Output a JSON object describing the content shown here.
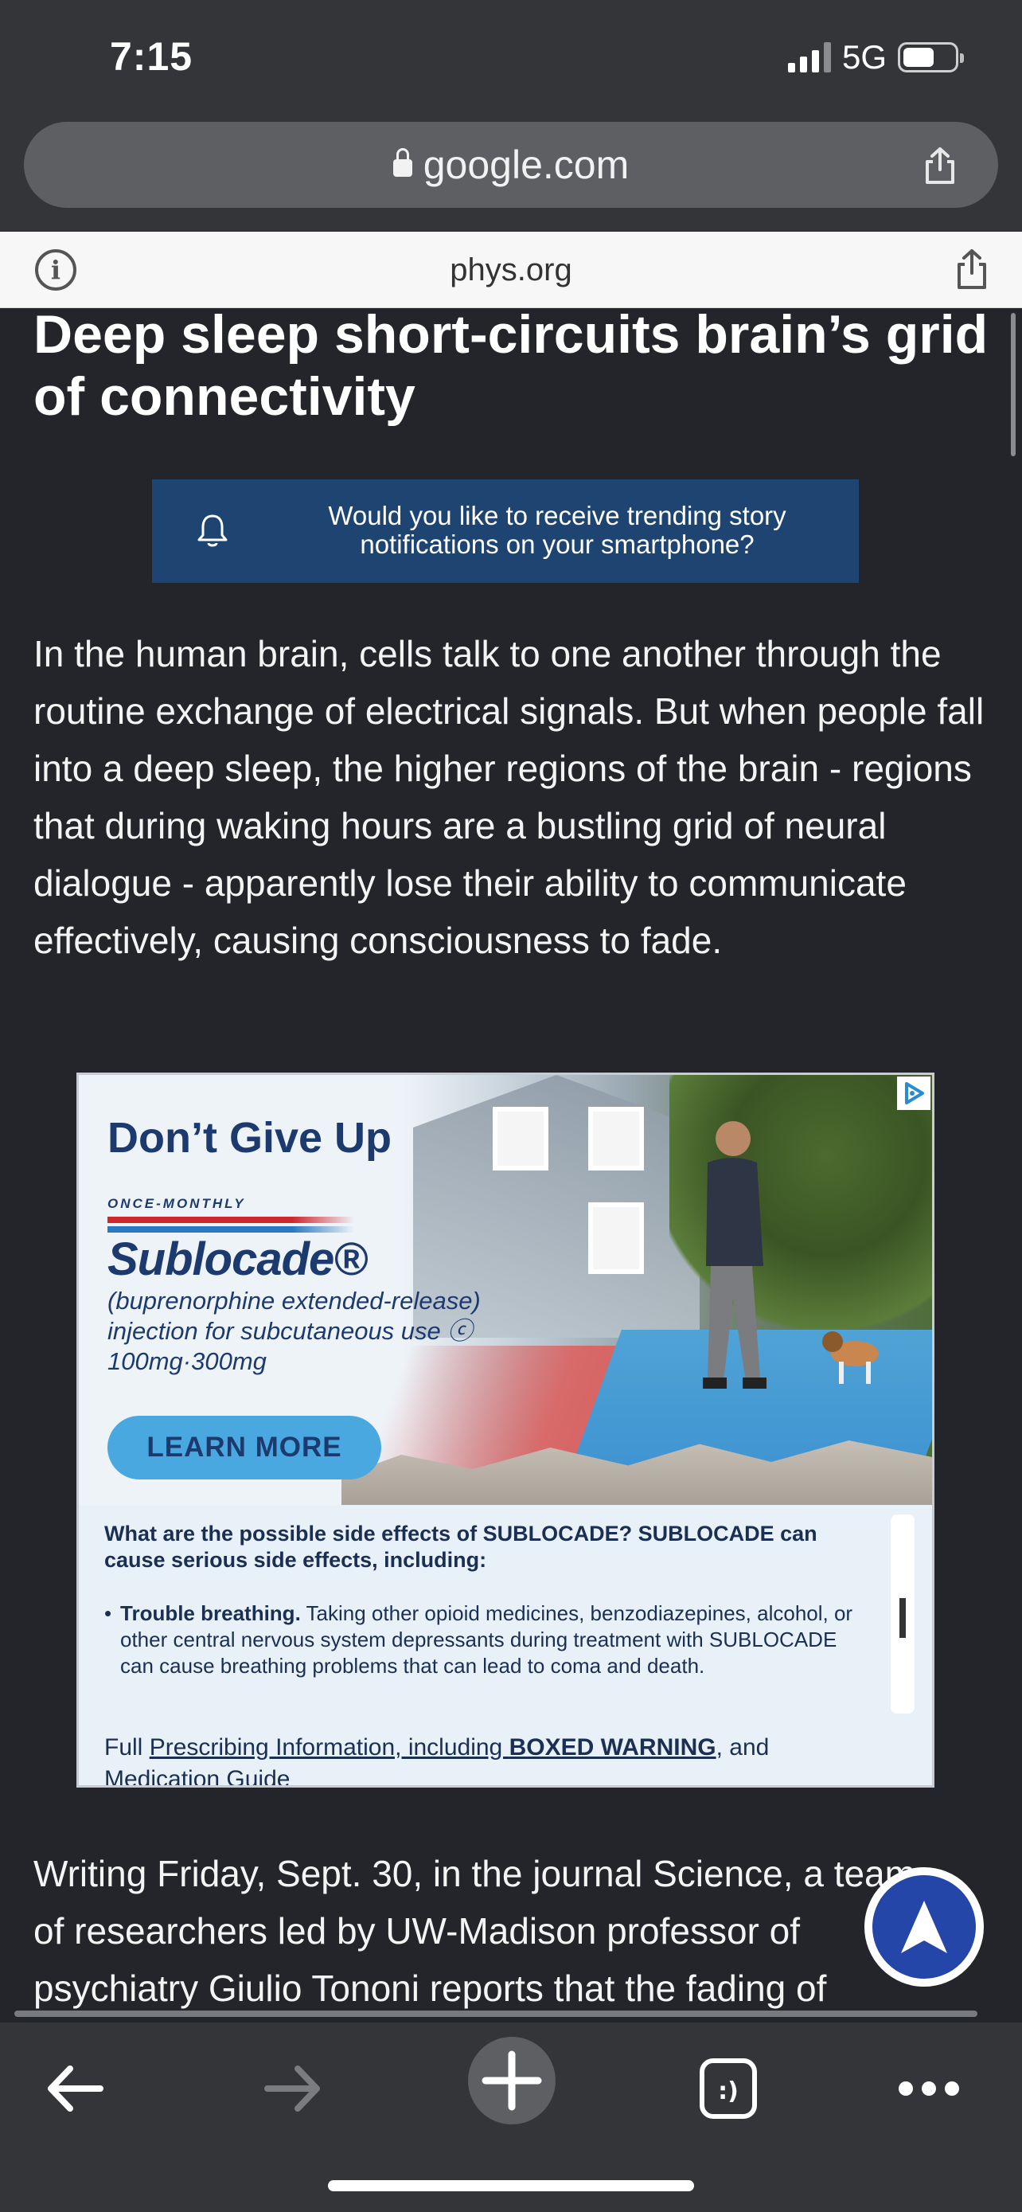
{
  "status_bar": {
    "time": "7:15",
    "network": "5G"
  },
  "url_bar": {
    "domain": "google.com"
  },
  "site_bar": {
    "site": "phys.org"
  },
  "article": {
    "headline": "Deep sleep short-circuits brain’s grid of connectivity",
    "notification_prompt": "Would you like to receive trending story notifications on your smartphone?",
    "paragraph_1": "In the human brain, cells talk to one another through the routine exchange of electrical signals. But when people fall into a deep sleep, the higher regions of the brain - regions that during waking hours are a bustling grid of neural dialogue - apparently lose their ability to communicate effectively, causing consciousness to fade.",
    "paragraph_2": "Writing Friday, Sept. 30, in the journal Science, a team of researchers led by UW-Madison professor of psychiatry Giulio Tononi reports that the fading of"
  },
  "ad": {
    "headline": "Don’t Give Up",
    "eyebrow": "ONCE-MONTHLY",
    "brand": "Sublocade®",
    "description": "(buprenorphine extended-release) injection for subcutaneous use ⓒ 100mg·300mg",
    "cta": "LEARN MORE",
    "isi_heading": "What are the possible side effects of SUBLOCADE? SUBLOCADE can cause serious side effects, including:",
    "isi_bullet_title": "Trouble breathing.",
    "isi_bullet_text": " Taking other opioid medicines, benzodiazepines, alcohol, or other central nervous system depressants during treatment with SUBLOCADE can cause breathing problems that can lead to coma and death.",
    "footer_prefix": "Full ",
    "footer_link_1": "Prescribing Information, including ",
    "footer_bold": "BOXED WARNING",
    "footer_mid": ", and ",
    "footer_link_2": "Medication Guide"
  },
  "colors": {
    "notification_bg": "#1e4571",
    "fab_bg": "#2446a8",
    "ad_brand": "#1d3a6e",
    "cta_bg": "#4aa8e0"
  },
  "icons": [
    "lock-icon",
    "share-icon",
    "info-icon",
    "bell-icon",
    "ad-choices-icon",
    "arrow-up-icon",
    "back-icon",
    "forward-icon",
    "plus-icon",
    "tabs-icon",
    "more-icon"
  ]
}
